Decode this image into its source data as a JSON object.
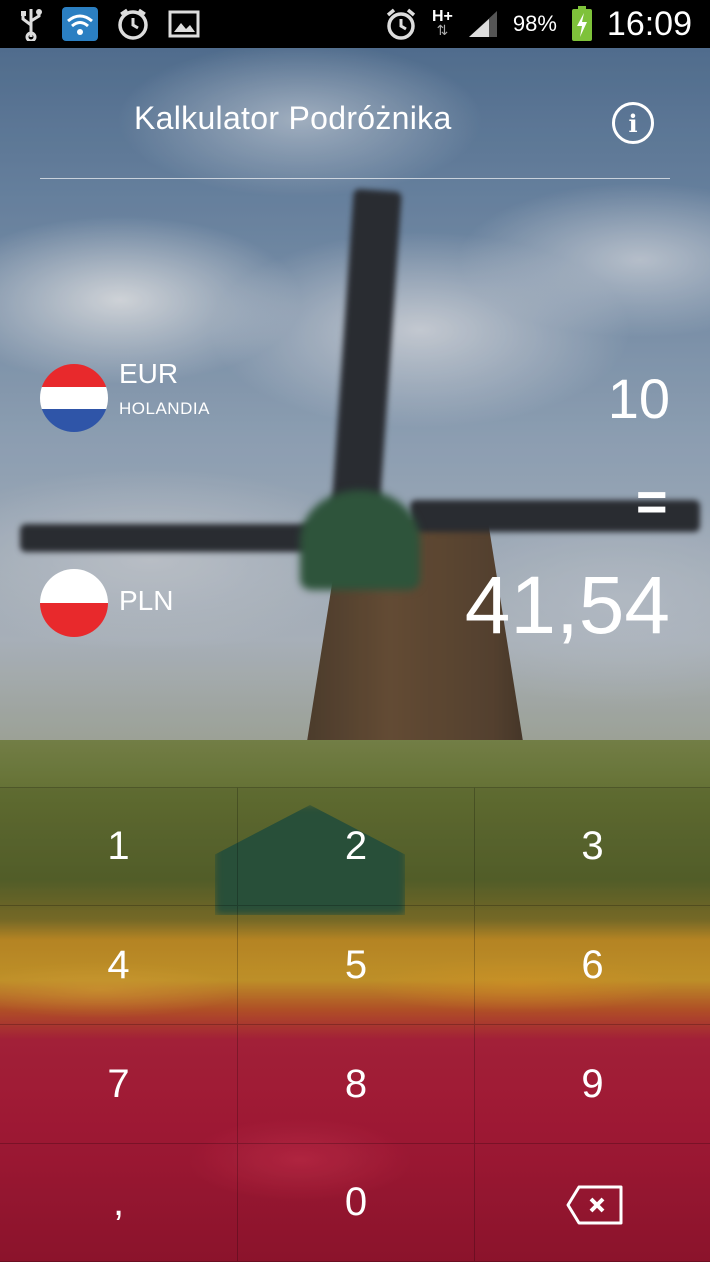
{
  "status_bar": {
    "icons_left": [
      "usb-icon",
      "wifi-icon",
      "alarm-app-icon",
      "gallery-icon"
    ],
    "icons_right": [
      "alarm-clock-icon",
      "network-type-icon",
      "signal-icon",
      "battery-icon"
    ],
    "network": "H+",
    "battery": "98%",
    "time": "16:09"
  },
  "header": {
    "title": "Kalkulator Podróżnika",
    "info_glyph": "i"
  },
  "from": {
    "code": "EUR",
    "country": "HOLANDIA",
    "amount": "10",
    "flag_colors": [
      "#e8292c",
      "#ffffff",
      "#2f55a8"
    ]
  },
  "equals": "=",
  "to": {
    "code": "PLN",
    "amount": "41,54",
    "flag_colors": [
      "#ffffff",
      "#e8292c"
    ]
  },
  "keypad": {
    "keys": [
      "1",
      "2",
      "3",
      "4",
      "5",
      "6",
      "7",
      "8",
      "9",
      ",",
      "0"
    ],
    "backspace_icon": "backspace-icon"
  }
}
